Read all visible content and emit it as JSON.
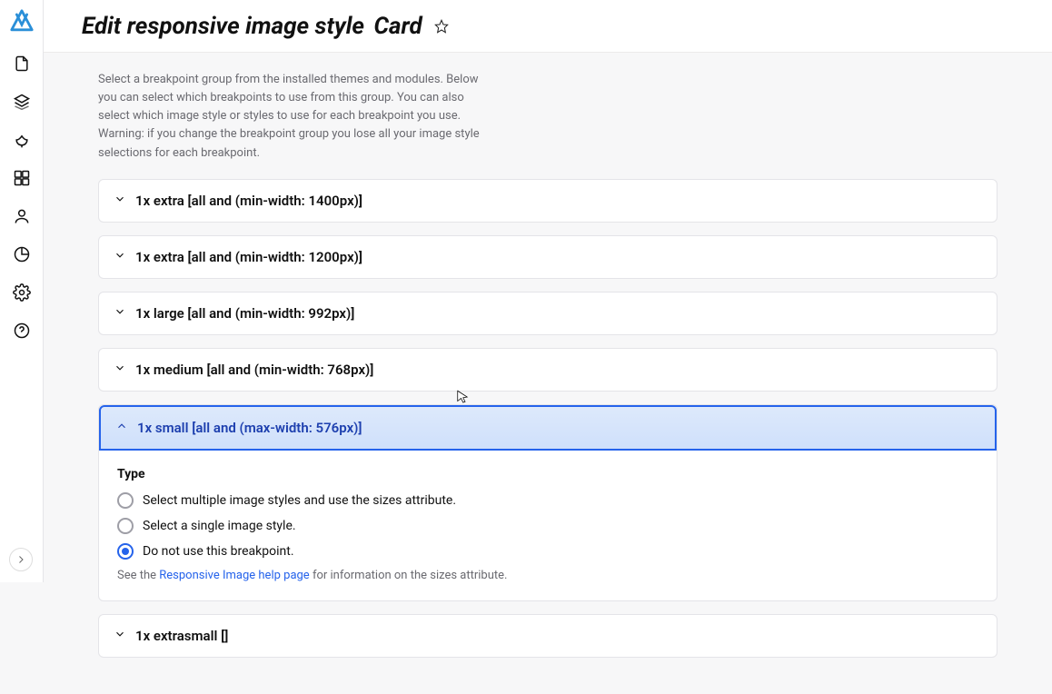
{
  "header": {
    "title_prefix": "Edit responsive image style",
    "title_name": "Card"
  },
  "helper": "Select a breakpoint group from the installed themes and modules. Below you can select which breakpoints to use from this group. You can also select which image style or styles to use for each breakpoint you use. Warning: if you change the breakpoint group you lose all your image style selections for each breakpoint.",
  "breakpoints": [
    {
      "label": "1x extra [all and (min-width: 1400px)]",
      "open": false
    },
    {
      "label": "1x extra [all and (min-width: 1200px)]",
      "open": false
    },
    {
      "label": "1x large [all and (min-width: 992px)]",
      "open": false
    },
    {
      "label": "1x medium [all and (min-width: 768px)]",
      "open": false
    },
    {
      "label": "1x small [all and (max-width: 576px)]",
      "open": true
    },
    {
      "label": "1x extrasmall []",
      "open": false
    }
  ],
  "type_section": {
    "label": "Type",
    "options": [
      "Select multiple image styles and use the sizes attribute.",
      "Select a single image style.",
      "Do not use this breakpoint."
    ],
    "selected_index": 2,
    "see_prefix": "See the ",
    "see_link": "Responsive Image help page",
    "see_suffix": " for information on the sizes attribute."
  },
  "sidebar_items": [
    "content",
    "structure",
    "appearance",
    "extend",
    "people",
    "reports",
    "configuration",
    "help"
  ]
}
